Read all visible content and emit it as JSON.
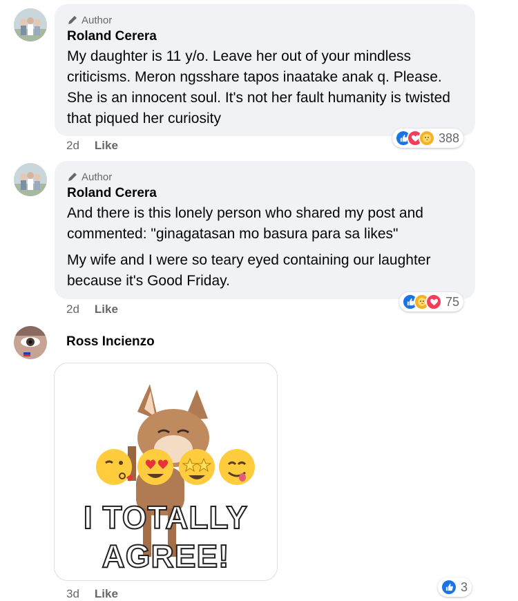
{
  "comments": [
    {
      "author_badge": "Author",
      "name": "Roland Cerera",
      "paragraphs": [
        "My daughter is 11 y/o. Leave her out of your mindless criticisms. Meron ngsshare tapos inaatake anak q. Please. She is an innocent soul. It's not her fault humanity is twisted that piqued her curiosity"
      ],
      "time": "2d",
      "like_label": "Like",
      "reactions": [
        "like",
        "love",
        "care"
      ],
      "reaction_count": "388"
    },
    {
      "author_badge": "Author",
      "name": "Roland Cerera",
      "paragraphs": [
        "And there is this lonely person who shared my post and commented: \"ginagatasan mo basura para sa likes\"",
        "My wife and I were so teary eyed containing our laughter because it's Good Friday."
      ],
      "time": "2d",
      "like_label": "Like",
      "reactions": [
        "like",
        "care",
        "love"
      ],
      "reaction_count": "75"
    },
    {
      "name": "Ross Incienzo",
      "gif_caption_line1": "I TOTALLY",
      "gif_caption_line2": "AGREE!",
      "time": "3d",
      "like_label": "Like",
      "reactions": [
        "like"
      ],
      "reaction_count": "3"
    }
  ],
  "icons": {
    "author_badge": "pencil-icon",
    "like": "thumbs-up-icon",
    "love": "heart-icon",
    "care": "care-hug-icon"
  },
  "colors": {
    "bubble": "#f0f2f5",
    "meta_text": "#65676b",
    "like_blue": "#1b74e4",
    "love_red": "#f33e58",
    "care_yellow": "#f7b125"
  }
}
